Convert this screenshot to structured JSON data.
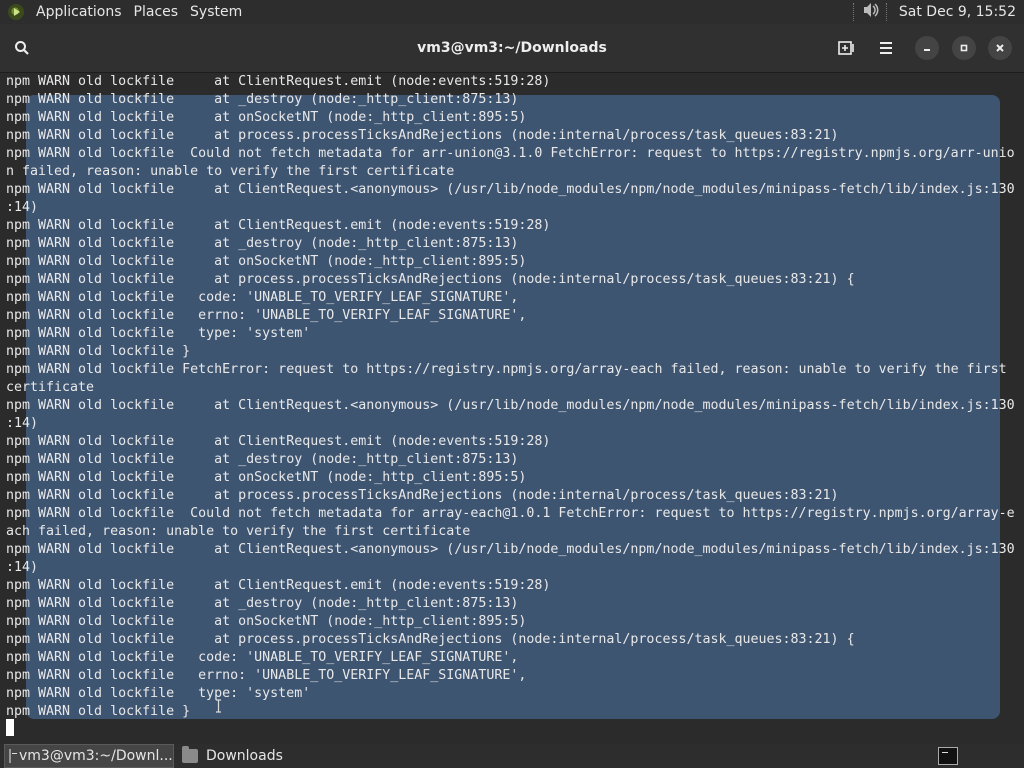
{
  "top_panel": {
    "menus": [
      "Applications",
      "Places",
      "System"
    ],
    "clock": "Sat Dec  9, 15:52",
    "icons": [
      "distro-logo-icon",
      "volume-icon"
    ]
  },
  "window": {
    "title": "vm3@vm3:~/Downloads",
    "buttons": [
      "search-icon",
      "new-tab-icon",
      "hamburger-menu-icon",
      "minimize-icon",
      "maximize-icon",
      "close-icon"
    ]
  },
  "terminal": {
    "colors": {
      "background": "#2b2b2b",
      "selection": "#3e5572",
      "text": "#e8e8e8"
    },
    "lines": [
      "npm WARN old lockfile     at ClientRequest.emit (node:events:519:28)",
      "npm WARN old lockfile     at _destroy (node:_http_client:875:13)",
      "npm WARN old lockfile     at onSocketNT (node:_http_client:895:5)",
      "npm WARN old lockfile     at process.processTicksAndRejections (node:internal/process/task_queues:83:21)",
      "npm WARN old lockfile  Could not fetch metadata for arr-union@3.1.0 FetchError: request to https://registry.npmjs.org/arr-unio",
      "n failed, reason: unable to verify the first certificate",
      "npm WARN old lockfile     at ClientRequest.<anonymous> (/usr/lib/node_modules/npm/node_modules/minipass-fetch/lib/index.js:130",
      ":14)",
      "npm WARN old lockfile     at ClientRequest.emit (node:events:519:28)",
      "npm WARN old lockfile     at _destroy (node:_http_client:875:13)",
      "npm WARN old lockfile     at onSocketNT (node:_http_client:895:5)",
      "npm WARN old lockfile     at process.processTicksAndRejections (node:internal/process/task_queues:83:21) {",
      "npm WARN old lockfile   code: 'UNABLE_TO_VERIFY_LEAF_SIGNATURE',",
      "npm WARN old lockfile   errno: 'UNABLE_TO_VERIFY_LEAF_SIGNATURE',",
      "npm WARN old lockfile   type: 'system'",
      "npm WARN old lockfile }",
      "npm WARN old lockfile FetchError: request to https://registry.npmjs.org/array-each failed, reason: unable to verify the first",
      "certificate",
      "npm WARN old lockfile     at ClientRequest.<anonymous> (/usr/lib/node_modules/npm/node_modules/minipass-fetch/lib/index.js:130",
      ":14)",
      "npm WARN old lockfile     at ClientRequest.emit (node:events:519:28)",
      "npm WARN old lockfile     at _destroy (node:_http_client:875:13)",
      "npm WARN old lockfile     at onSocketNT (node:_http_client:895:5)",
      "npm WARN old lockfile     at process.processTicksAndRejections (node:internal/process/task_queues:83:21)",
      "npm WARN old lockfile  Could not fetch metadata for array-each@1.0.1 FetchError: request to https://registry.npmjs.org/array-e",
      "ach failed, reason: unable to verify the first certificate",
      "npm WARN old lockfile     at ClientRequest.<anonymous> (/usr/lib/node_modules/npm/node_modules/minipass-fetch/lib/index.js:130",
      ":14)",
      "npm WARN old lockfile     at ClientRequest.emit (node:events:519:28)",
      "npm WARN old lockfile     at _destroy (node:_http_client:875:13)",
      "npm WARN old lockfile     at onSocketNT (node:_http_client:895:5)",
      "npm WARN old lockfile     at process.processTicksAndRejections (node:internal/process/task_queues:83:21) {",
      "npm WARN old lockfile   code: 'UNABLE_TO_VERIFY_LEAF_SIGNATURE',",
      "npm WARN old lockfile   errno: 'UNABLE_TO_VERIFY_LEAF_SIGNATURE',",
      "npm WARN old lockfile   type: 'system'",
      "npm WARN old lockfile }"
    ]
  },
  "taskbar": {
    "tasks": [
      {
        "label": "vm3@vm3:~/Downl...",
        "icon": "terminal-icon",
        "active": true
      },
      {
        "label": "Downloads",
        "icon": "folder-icon",
        "active": false
      }
    ],
    "tray_icon": "terminal-icon"
  }
}
